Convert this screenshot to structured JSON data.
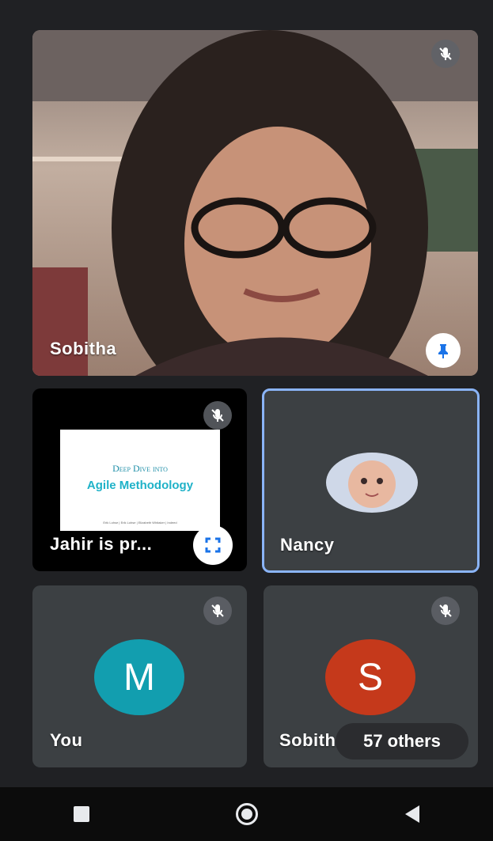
{
  "participants": {
    "main": {
      "name": "Sobitha"
    },
    "presenter": {
      "name": "Jahir is pr...",
      "slide_title": "Deep Dive into",
      "slide_subtitle": "Agile Methodology",
      "slide_footer": "Erik Lohse | Erik Lohse | Elizabeth Whitaker | Indeed"
    },
    "nancy": {
      "name": "Nancy"
    },
    "you": {
      "name": "You",
      "initial": "M",
      "color": "#129eaf"
    },
    "sobitha2": {
      "name": "Sobith",
      "initial": "S",
      "color": "#c5391b"
    }
  },
  "others_badge": "57 others",
  "colors": {
    "accent": "#8ab4f8",
    "tile_bg": "#3c4043",
    "page_bg": "#202124"
  },
  "icons": [
    "mic-off-icon",
    "pin-icon",
    "fullscreen-icon",
    "nav-back-icon",
    "nav-home-icon",
    "nav-recents-icon"
  ]
}
